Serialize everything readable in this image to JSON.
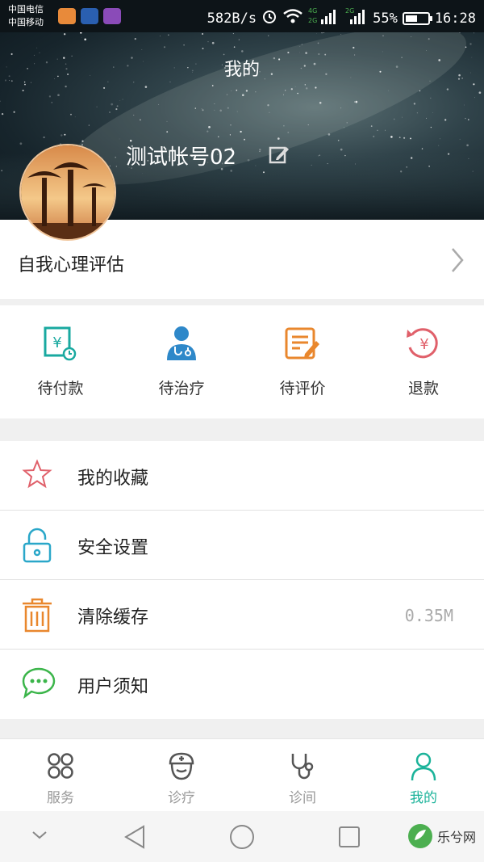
{
  "status_bar": {
    "carrier_1": "中国电信",
    "carrier_2": "中国移动",
    "net_speed": "582B/s",
    "net_tag_4g": "4G",
    "net_tag_2g_a": "2G",
    "net_tag_2g_b": "2G",
    "battery": "55%",
    "battery_level": 0.55,
    "time": "16:28"
  },
  "header": {
    "title": "我的",
    "username": "测试帐号02"
  },
  "self_assessment": {
    "label": "自我心理评估"
  },
  "orders": [
    {
      "label": "待付款",
      "icon": "pending-payment-icon",
      "color": "#19a9a0"
    },
    {
      "label": "待治疗",
      "icon": "doctor-icon",
      "color": "#2e88c9"
    },
    {
      "label": "待评价",
      "icon": "edit-document-icon",
      "color": "#e9872d"
    },
    {
      "label": "退款",
      "icon": "refund-icon",
      "color": "#e0606a"
    }
  ],
  "menu": [
    {
      "label": "我的收藏",
      "icon": "star-icon",
      "color": "#e0606a",
      "value": ""
    },
    {
      "label": "安全设置",
      "icon": "lock-icon",
      "color": "#2aa7c9",
      "value": ""
    },
    {
      "label": "清除缓存",
      "icon": "trash-icon",
      "color": "#e9872d",
      "value": "0.35M"
    },
    {
      "label": "用户须知",
      "icon": "chat-bubble-icon",
      "color": "#3bb54a",
      "value": ""
    }
  ],
  "tabs": [
    {
      "label": "服务",
      "icon": "grid-icon",
      "active": false
    },
    {
      "label": "诊疗",
      "icon": "nurse-icon",
      "active": false
    },
    {
      "label": "诊间",
      "icon": "stethoscope-icon",
      "active": false
    },
    {
      "label": "我的",
      "icon": "person-icon",
      "active": true
    }
  ],
  "colors": {
    "accent": "#1bb39a",
    "inactive_tab": "#999999"
  },
  "watermark": "乐兮网"
}
